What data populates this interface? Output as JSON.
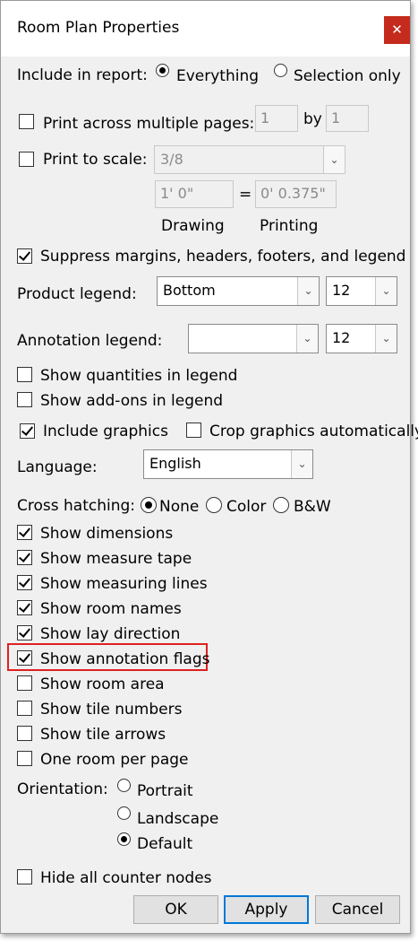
{
  "window": {
    "title": "Room Plan Properties",
    "close_glyph": "✕"
  },
  "include_report": {
    "label": "Include in report:",
    "options": [
      "Everything",
      "Selection only"
    ],
    "selected": "Everything"
  },
  "print_multi": {
    "label": "Print across multiple pages:",
    "checked": false,
    "pages_x": "1",
    "by_label": "by",
    "pages_y": "1"
  },
  "print_scale": {
    "label": "Print to scale:",
    "checked": false,
    "scale_value": "3/8",
    "drawing_value": "1' 0\"",
    "equals": "=",
    "printing_value": "0' 0.375\"",
    "drawing_label": "Drawing",
    "printing_label": "Printing"
  },
  "suppress": {
    "label": "Suppress margins, headers, footers, and legend",
    "checked": true
  },
  "product_legend": {
    "label": "Product legend:",
    "value": "Bottom",
    "size": "12"
  },
  "annotation_legend": {
    "label": "Annotation legend:",
    "value": "",
    "size": "12"
  },
  "show_quantities": {
    "label": "Show quantities in legend",
    "checked": false
  },
  "show_addons": {
    "label": "Show add-ons in legend",
    "checked": false
  },
  "include_graphics": {
    "label": "Include graphics",
    "checked": true
  },
  "crop_graphics": {
    "label": "Crop graphics automatically",
    "checked": false
  },
  "language": {
    "label": "Language:",
    "value": "English"
  },
  "cross_hatching": {
    "label": "Cross hatching:",
    "options": [
      "None",
      "Color",
      "B&W"
    ],
    "selected": "None"
  },
  "show_options": [
    {
      "label": "Show dimensions",
      "checked": true
    },
    {
      "label": "Show measure tape",
      "checked": true
    },
    {
      "label": "Show measuring lines",
      "checked": true
    },
    {
      "label": "Show room names",
      "checked": true
    },
    {
      "label": "Show lay direction",
      "checked": true
    },
    {
      "label": "Show annotation flags",
      "checked": true
    },
    {
      "label": "Show room area",
      "checked": false
    },
    {
      "label": "Show tile numbers",
      "checked": false
    },
    {
      "label": "Show tile arrows",
      "checked": false
    },
    {
      "label": "One room per page",
      "checked": false
    }
  ],
  "orientation": {
    "label": "Orientation:",
    "options": [
      "Portrait",
      "Landscape",
      "Default"
    ],
    "selected": "Default"
  },
  "hide_counter": {
    "label": "Hide all counter nodes",
    "checked": false
  },
  "buttons": {
    "ok": "OK",
    "apply": "Apply",
    "cancel": "Cancel"
  },
  "colors": {
    "close_bg": "#c42b1c",
    "highlight": "#e02020",
    "default_button_border": "#0078d7"
  },
  "icons": {
    "dropdown": "chevron-down-icon",
    "close": "close-icon"
  }
}
